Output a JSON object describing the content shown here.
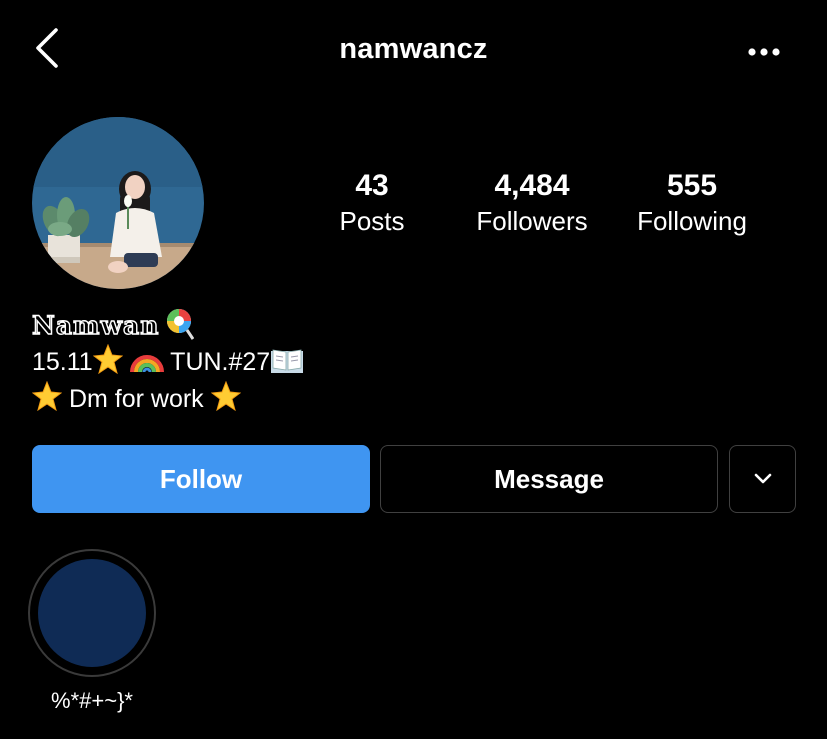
{
  "header": {
    "username": "namwancz",
    "back_icon": "chevron-left-icon",
    "more_icon": "more-horizontal-icon"
  },
  "profile": {
    "avatar": "profile-photo",
    "stats": [
      {
        "value": "43",
        "label": "Posts"
      },
      {
        "value": "4,484",
        "label": "Followers"
      },
      {
        "value": "555",
        "label": "Following"
      }
    ]
  },
  "bio": {
    "display_name": "Namwan",
    "line1_date": "15.11",
    "line1_text": "TUN.#27",
    "line2_text": "Dm for work",
    "emoji_names": [
      "lollipop",
      "glowing-star",
      "rainbow",
      "open-book"
    ]
  },
  "actions": {
    "follow_label": "Follow",
    "message_label": "Message",
    "dropdown_icon": "chevron-down-icon"
  },
  "highlights": [
    {
      "label": "%*#+~}*"
    }
  ],
  "colors": {
    "background": "#000000",
    "follow_blue": "#3f95f1",
    "button_border": "#404040",
    "highlight_fill": "#0f2b55"
  }
}
